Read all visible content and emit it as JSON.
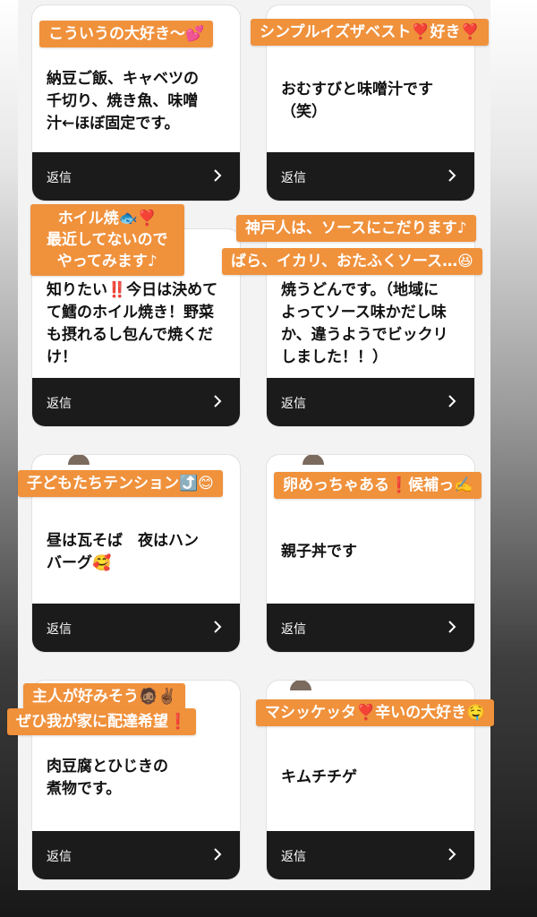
{
  "colors": {
    "sticker_bg": "#f0913c",
    "card_footer": "#1b1b1b",
    "card_bg": "#ffffff"
  },
  "reply_label": "返信",
  "cards": [
    {
      "text": "納豆ご飯、キャベツの\n千切り、焼き魚、味噌\n汁←ほぼ固定です。"
    },
    {
      "text": "おむすびと味噌汁です\n（笑）"
    },
    {
      "text": "知りたい‼️今日は決めて\nて鱈のホイル焼き！野菜\nも摂れるし包んで焼くだ\nけ！"
    },
    {
      "text": "焼うどんです。（地域に\nよってソース味かだし味\nか、違うようでビックリ\nしました！！）"
    },
    {
      "text": "昼は瓦そば　夜はハン\nバーグ🥰"
    },
    {
      "text": "親子丼です"
    },
    {
      "text": "肉豆腐とひじきの\n煮物です。"
    },
    {
      "text": "キムチチゲ"
    }
  ],
  "stickers": [
    {
      "lines": [
        "こういうの大好き〜💕"
      ]
    },
    {
      "lines": [
        "シンプルイズザベスト❣️好き❣️"
      ]
    },
    {
      "lines": [
        "ホイル焼🐟❣️",
        "最近してないので",
        "やってみます♪"
      ]
    },
    {
      "lines": [
        "神戸人は、ソースにこだります♪"
      ]
    },
    {
      "lines": [
        "ばら、イカリ、おたふくソース…😆"
      ]
    },
    {
      "lines": [
        "子どもたちテンション⤴️😊"
      ]
    },
    {
      "lines": [
        "卵めっちゃある❗️候補っ✍️"
      ]
    },
    {
      "lines": [
        "主人が好みそう🧔🏽✌🏾"
      ]
    },
    {
      "lines": [
        "ぜひ我が家に配達希望❗️"
      ]
    },
    {
      "lines": [
        "マシッケッタ❣️辛いの大好き🤤"
      ]
    }
  ]
}
